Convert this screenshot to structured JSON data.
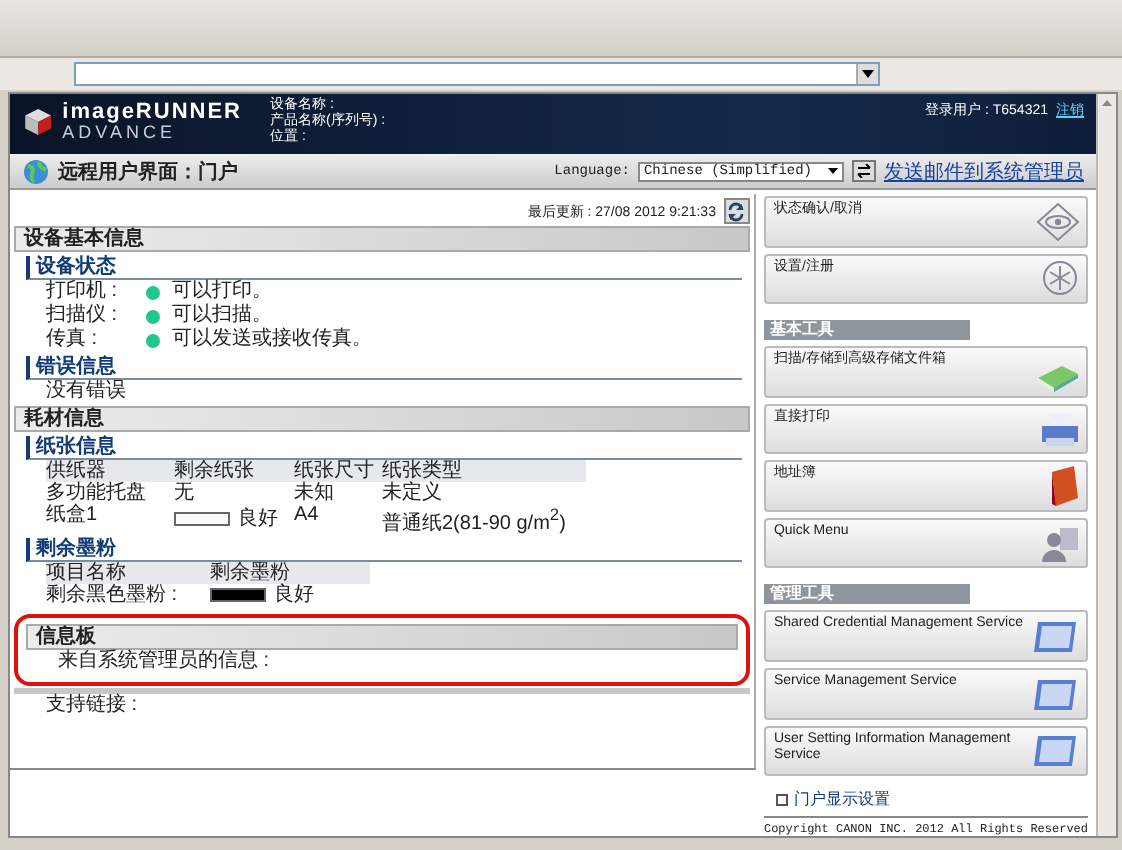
{
  "header": {
    "logo_line1": "imageRUNNER",
    "logo_line2": "ADVANCE",
    "device_fields": [
      "设备名称 :",
      "产品名称(序列号) :",
      "位置 :"
    ],
    "login_label": "登录用户 : T654321",
    "logout_link": "注销"
  },
  "title_bar": {
    "title": "远程用户界面：门户",
    "language_label": "Language:",
    "language_value": "Chinese (Simplified)",
    "mail_link": "发送邮件到系统管理员"
  },
  "last_update": "最后更新 : 27/08 2012 9:21:33",
  "device_info": {
    "title": "设备基本信息",
    "status_heading": "设备状态",
    "statuses": [
      {
        "label": "打印机 :",
        "text": "可以打印。",
        "color": "#20c890"
      },
      {
        "label": "扫描仪 :",
        "text": "可以扫描。",
        "color": "#20c890"
      },
      {
        "label": "传真 :",
        "text": "可以发送或接收传真。",
        "color": "#20c890"
      }
    ],
    "error_heading": "错误信息",
    "error_text": "没有错误"
  },
  "consumables": {
    "title": "耗材信息",
    "paper_heading": "纸张信息",
    "paper_columns": [
      "供纸器",
      "剩余纸张",
      "纸张尺寸",
      "纸张类型"
    ],
    "paper_rows": [
      {
        "source": "多功能托盘",
        "remaining": "无",
        "size": "未知",
        "type": "未定义"
      },
      {
        "source": "纸盒1",
        "level": 1,
        "remaining": "良好",
        "size": "A4",
        "type": "普通纸2(81-90 g/m$^{2}$)"
      }
    ],
    "toner_heading": "剩余墨粉",
    "toner_columns": [
      "项目名称",
      "剩余墨粉"
    ],
    "toner_rows": [
      {
        "name": "剩余黑色墨粉 :",
        "level": 1,
        "status": "良好"
      }
    ]
  },
  "message_board": {
    "title": "信息板",
    "text": "来自系统管理员的信息 :"
  },
  "support": {
    "text": "支持链接 :"
  },
  "side_groups": [
    {
      "buttons": [
        {
          "label": "状态确认/取消",
          "kind": "status"
        },
        {
          "label": "设置/注册",
          "kind": "settings"
        }
      ]
    },
    {
      "title": "基本工具",
      "buttons": [
        {
          "label": "扫描/存储到高级存储文件箱",
          "kind": "storage"
        },
        {
          "label": "直接打印",
          "kind": "print"
        },
        {
          "label": "地址簿",
          "kind": "addressbook"
        },
        {
          "label": "Quick Menu",
          "kind": "quickmenu"
        }
      ]
    },
    {
      "title": "管理工具",
      "buttons": [
        {
          "label": "Shared Credential Management Service",
          "kind": "service"
        },
        {
          "label": "Service Management Service",
          "kind": "service"
        },
        {
          "label": "User Setting Information Management Service",
          "kind": "service"
        }
      ]
    }
  ],
  "portal_link": "门户显示设置",
  "copyright": "Copyright CANON INC. 2012 All Rights Reserved"
}
